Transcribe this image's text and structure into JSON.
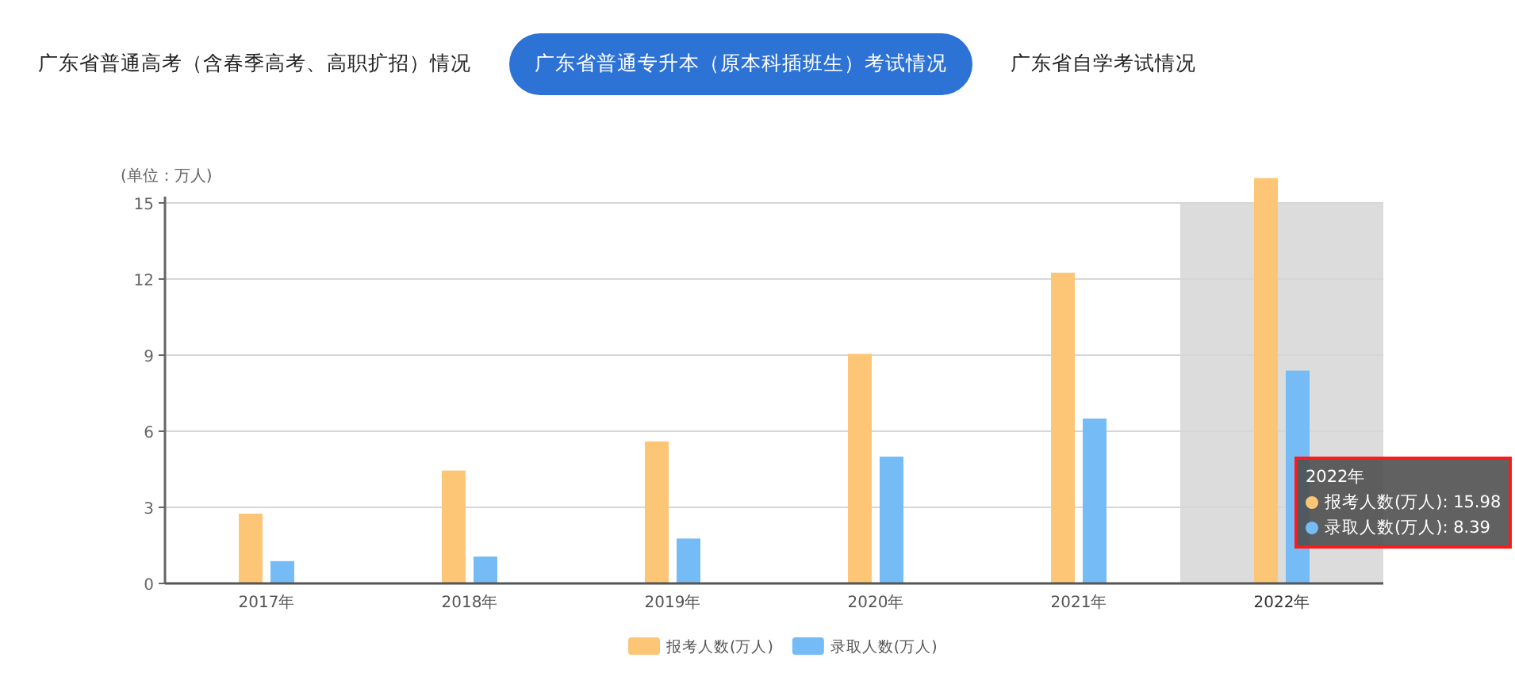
{
  "tabs": [
    {
      "label": "广东省普通高考（含春季高考、高职扩招）情况",
      "selected": false
    },
    {
      "label": "广东省普通专升本（原本科插班生）考试情况",
      "selected": true
    },
    {
      "label": "广东省自学考试情况",
      "selected": false
    }
  ],
  "chart": {
    "unit_label": "(单位：万人)",
    "chart_data": {
      "type": "bar",
      "categories": [
        "2017年",
        "2018年",
        "2019年",
        "2020年",
        "2021年",
        "2022年"
      ],
      "series": [
        {
          "name": "报考人数(万人)",
          "color": "#fdc677",
          "values": [
            2.75,
            4.45,
            5.6,
            9.05,
            12.25,
            15.98
          ]
        },
        {
          "name": "录取人数(万人)",
          "color": "#75bcf6",
          "values": [
            0.88,
            1.06,
            1.77,
            5.0,
            6.5,
            8.39
          ]
        }
      ],
      "ylim": [
        0,
        16
      ],
      "yticks": [
        0,
        3,
        6,
        9,
        12,
        15
      ],
      "grid": true,
      "legend": true
    },
    "category_states": [
      {
        "selected": false
      },
      {
        "selected": false
      },
      {
        "selected": false
      },
      {
        "selected": false
      },
      {
        "selected": false
      },
      {
        "selected": true
      }
    ],
    "tooltip": {
      "title": "2022年",
      "highlighted": true,
      "rows": [
        {
          "label": "报考人数(万人): 15.98",
          "color": "#fdc677"
        },
        {
          "label": "录取人数(万人): 8.39",
          "color": "#75bcf6"
        }
      ]
    }
  }
}
